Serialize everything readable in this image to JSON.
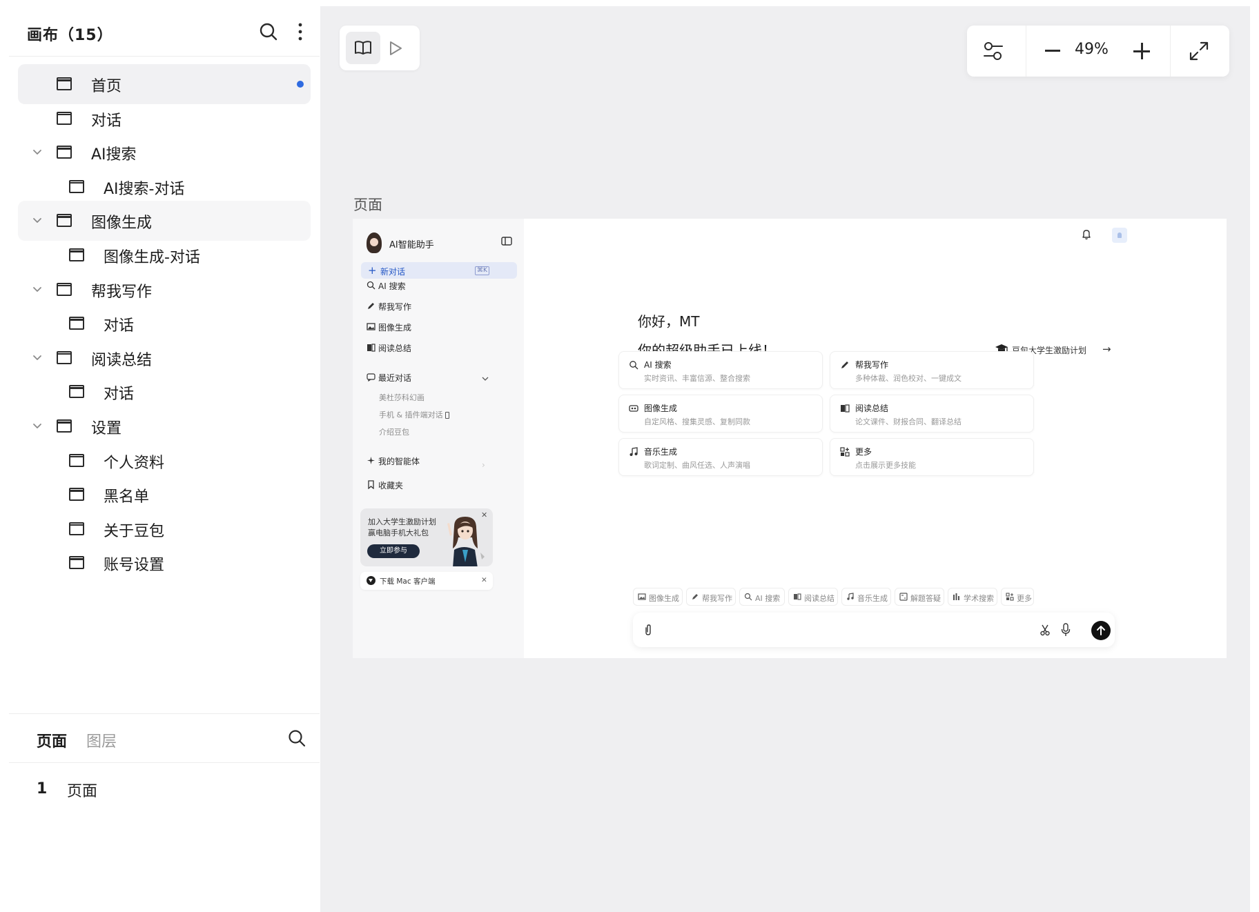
{
  "layers_panel": {
    "title": "画布（15）",
    "tree": [
      {
        "label": "首页",
        "level": 0,
        "selected": true,
        "has_dot": true,
        "expandable": false
      },
      {
        "label": "对话",
        "level": 0,
        "expandable": false
      },
      {
        "label": "AI搜索",
        "level": 0,
        "expandable": true
      },
      {
        "label": "AI搜索-对话",
        "level": 1
      },
      {
        "label": "图像生成",
        "level": 0,
        "expandable": true,
        "hovered": true
      },
      {
        "label": "图像生成-对话",
        "level": 1
      },
      {
        "label": "帮我写作",
        "level": 0,
        "expandable": true
      },
      {
        "label": "对话",
        "level": 1
      },
      {
        "label": "阅读总结",
        "level": 0,
        "expandable": true
      },
      {
        "label": "对话",
        "level": 1
      },
      {
        "label": "设置",
        "level": 0,
        "expandable": true
      },
      {
        "label": "个人资料",
        "level": 1
      },
      {
        "label": "黑名单",
        "level": 1
      },
      {
        "label": "关于豆包",
        "level": 1
      },
      {
        "label": "账号设置",
        "level": 1
      }
    ],
    "tabs": {
      "pages": "页面",
      "layers": "图层"
    },
    "pages": [
      {
        "number": "1",
        "name": "页面"
      }
    ]
  },
  "canvas": {
    "zoom": "49%",
    "frame_label": "页面"
  },
  "preview": {
    "sidebar": {
      "brand": "AI智能助手",
      "new_chat": "新对话",
      "new_chat_shortcut": "⌘K",
      "nav": [
        {
          "label": "AI 搜索",
          "icon": "search-icon"
        },
        {
          "label": "帮我写作",
          "icon": "pen-icon"
        },
        {
          "label": "图像生成",
          "icon": "image-icon"
        },
        {
          "label": "阅读总结",
          "icon": "book-icon"
        }
      ],
      "recent_label": "最近对话",
      "recent_items": [
        "美杜莎科幻画",
        "手机 & 插件端对话",
        "介绍豆包"
      ],
      "agents_label": "我的智能体",
      "favorites_label": "收藏夹",
      "promo": {
        "line1": "加入大学生激励计划",
        "line2": "赢电脑手机大礼包",
        "button": "立即参与"
      },
      "download": "下载 Mac 客户端"
    },
    "main": {
      "greeting": "你好，MT",
      "headline": "你的超级助手已上线！",
      "promo_link": "豆包大学生激励计划",
      "cards": [
        {
          "title": "AI 搜索",
          "desc": "实时资讯、丰富信源、整合搜索",
          "icon": "search-icon"
        },
        {
          "title": "帮我写作",
          "desc": "多种体裁、润色校对、一键成文",
          "icon": "pen-icon"
        },
        {
          "title": "图像生成",
          "desc": "自定风格、搜集灵感、复制同款",
          "icon": "palette-icon"
        },
        {
          "title": "阅读总结",
          "desc": "论文课件、财报合同、翻译总结",
          "icon": "book-icon"
        },
        {
          "title": "音乐生成",
          "desc": "歌词定制、曲风任选、人声演唱",
          "icon": "music-icon"
        },
        {
          "title": "更多",
          "desc": "点击展示更多技能",
          "icon": "grid-plus-icon"
        }
      ],
      "chips": [
        "图像生成",
        "帮我写作",
        "AI 搜索",
        "阅读总结",
        "音乐生成",
        "解题答疑",
        "学术搜索",
        "更多"
      ]
    }
  }
}
